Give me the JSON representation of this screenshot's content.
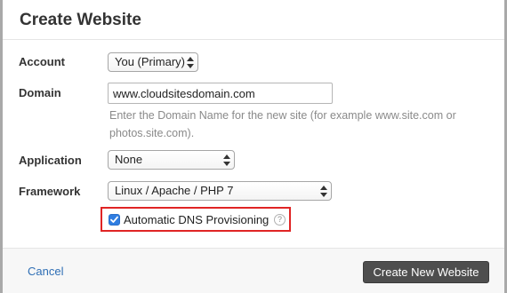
{
  "dialog": {
    "title": "Create Website"
  },
  "form": {
    "account": {
      "label": "Account",
      "value": "You (Primary)"
    },
    "domain": {
      "label": "Domain",
      "value": "www.cloudsitesdomain.com",
      "help": "Enter the Domain Name for the new site (for example www.site.com or photos.site.com)."
    },
    "application": {
      "label": "Application",
      "value": "None"
    },
    "framework": {
      "label": "Framework",
      "value": "Linux / Apache / PHP 7"
    },
    "dns": {
      "label": "Automatic DNS Provisioning",
      "checked": true,
      "help_icon": "question-mark-icon"
    }
  },
  "footer": {
    "cancel_label": "Cancel",
    "submit_label": "Create New Website"
  },
  "colors": {
    "link": "#2f6fb5",
    "primary_button": "#4e4e4e",
    "highlight_border": "#e02424",
    "checkbox": "#2f7de1"
  }
}
